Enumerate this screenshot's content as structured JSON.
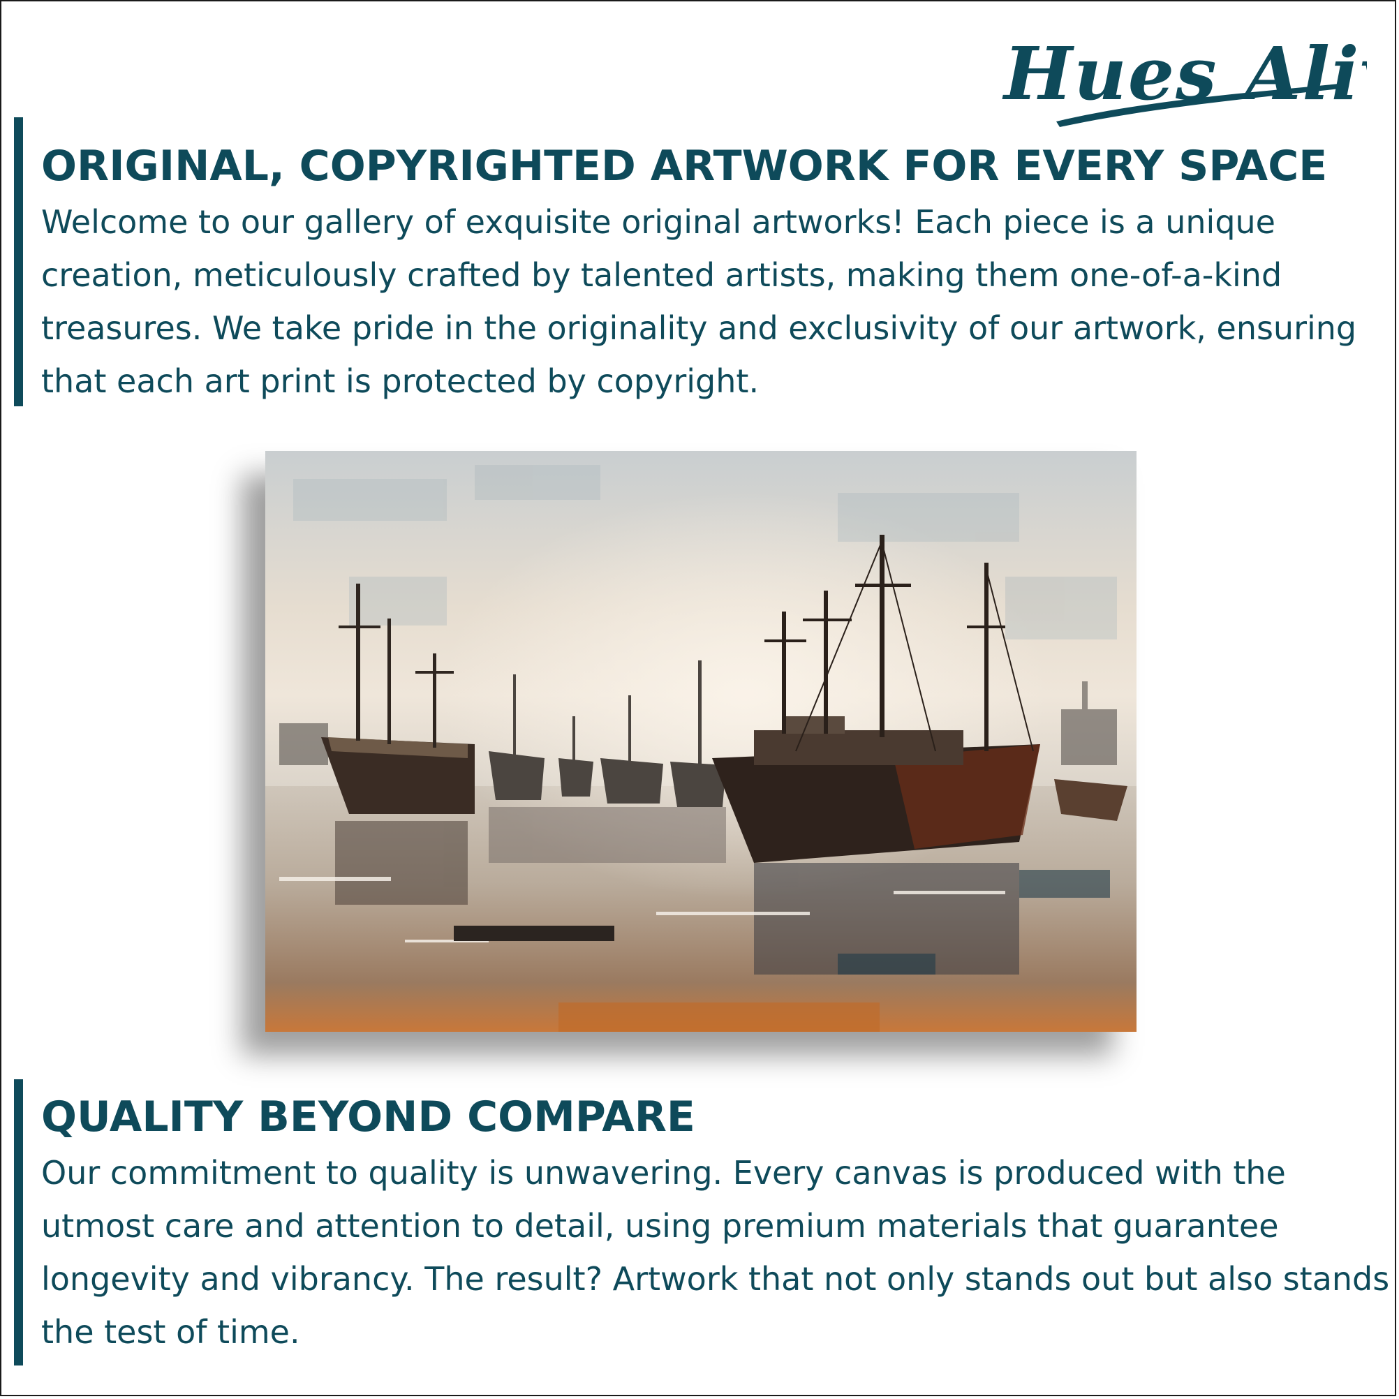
{
  "brand": {
    "logo_text": "Hues Alive",
    "color": "#0e4a5a"
  },
  "section_one": {
    "heading": "ORIGINAL, COPYRIGHTED ARTWORK FOR EVERY SPACE",
    "body": "Welcome to our gallery of exquisite original artworks! Each piece is a unique creation, meticulously crafted by talented artists, making them one-of-a-kind treasures. We take pride in the originality and exclusivity of our artwork, ensuring that each art print is protected by copyright."
  },
  "artwork": {
    "subject": "harbor-ships-painting"
  },
  "section_two": {
    "heading": "QUALITY BEYOND COMPARE",
    "body": "Our commitment to quality is unwavering. Every canvas is produced with the utmost care and attention to detail, using premium materials that guarantee longevity and vibrancy. The result? Artwork that not only stands out but also stands the test of time."
  }
}
